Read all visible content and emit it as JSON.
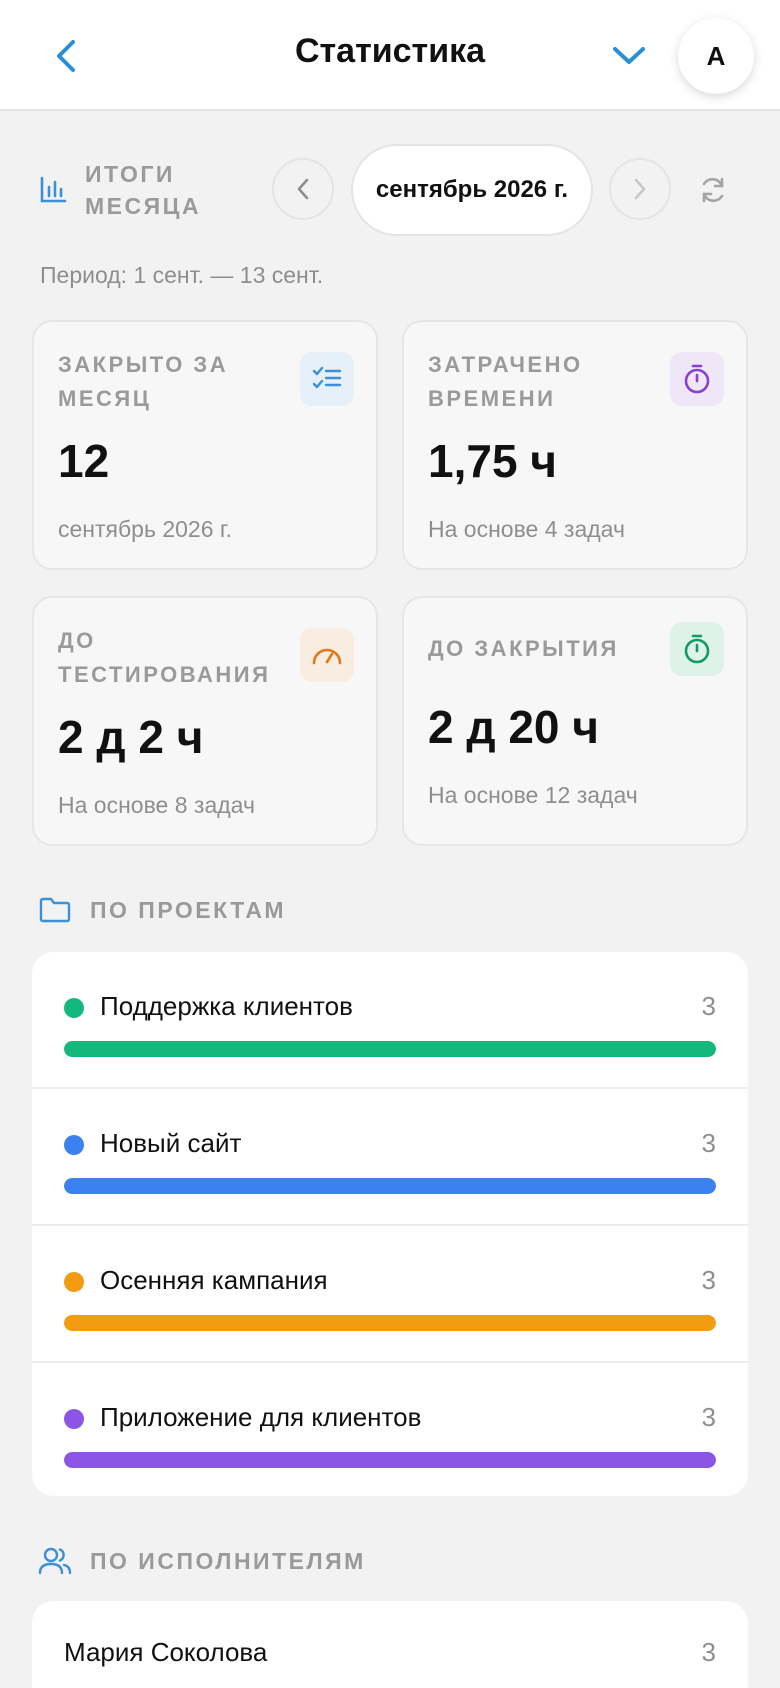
{
  "header": {
    "title": "Статистика",
    "avatar_letter": "А",
    "accent_color": "#2a8fd4"
  },
  "summary": {
    "title": "Итоги месяца",
    "month": "сентябрь 2026 г.",
    "period": "Период: 1 сент. — 13 сент."
  },
  "cards": [
    {
      "label": "Закрыто за месяц",
      "value": "12",
      "sub": "сентябрь 2026 г.",
      "icon": "checklist-icon",
      "icon_color": "#3d8fd6",
      "icon_bg": "#e6f0f9"
    },
    {
      "label": "Затрачено времени",
      "value": "1,75 ч",
      "sub": "На основе 4 задач",
      "icon": "stopwatch-icon",
      "icon_color": "#8a3fd1",
      "icon_bg": "#efe6f8"
    },
    {
      "label": "До тестирования",
      "value": "2 д 2 ч",
      "sub": "На основе 8 задач",
      "icon": "speedometer-icon",
      "icon_color": "#e0781a",
      "icon_bg": "#f9ece0"
    },
    {
      "label": "До закрытия",
      "value": "2 д 20 ч",
      "sub": "На основе 12 задач",
      "icon": "timer-icon",
      "icon_color": "#129a63",
      "icon_bg": "#dff2ea"
    }
  ],
  "projects": {
    "title": "По проектам",
    "items": [
      {
        "name": "Поддержка клиентов",
        "count": "3",
        "share": 1.0,
        "color": "#14b87c"
      },
      {
        "name": "Новый сайт",
        "count": "3",
        "share": 1.0,
        "color": "#3b82f0"
      },
      {
        "name": "Осенняя кампания",
        "count": "3",
        "share": 1.0,
        "color": "#f39c12"
      },
      {
        "name": "Приложение для клиентов",
        "count": "3",
        "share": 1.0,
        "color": "#8b55e6"
      }
    ]
  },
  "assignees": {
    "title": "По исполнителям",
    "items": [
      {
        "name": "Мария Соколова",
        "count": "3"
      }
    ]
  }
}
